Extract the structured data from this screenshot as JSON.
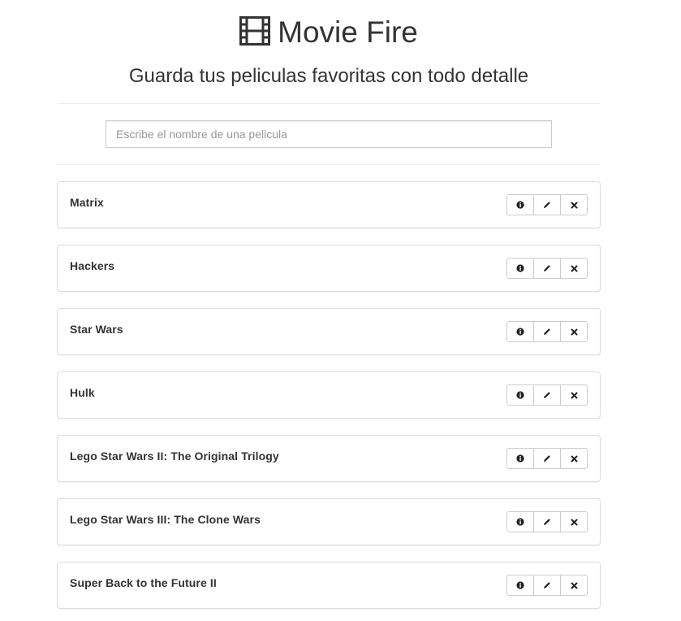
{
  "header": {
    "title": "Movie Fire",
    "subtitle": "Guarda tus peliculas favoritas con todo detalle",
    "icon": "film-icon"
  },
  "search": {
    "placeholder": "Escribe el nombre de una pelicula",
    "value": ""
  },
  "movies": [
    {
      "title": "Matrix"
    },
    {
      "title": "Hackers"
    },
    {
      "title": "Star Wars"
    },
    {
      "title": "Hulk"
    },
    {
      "title": "Lego Star Wars II: The Original Trilogy"
    },
    {
      "title": "Lego Star Wars III: The Clone Wars"
    },
    {
      "title": "Super Back to the Future II"
    }
  ],
  "actions": [
    {
      "icon": "info-icon"
    },
    {
      "icon": "pencil-icon"
    },
    {
      "icon": "remove-icon"
    }
  ],
  "colors": {
    "text": "#333333",
    "border": "#dddddd",
    "divider": "#eeeeee",
    "placeholder": "#999999"
  }
}
